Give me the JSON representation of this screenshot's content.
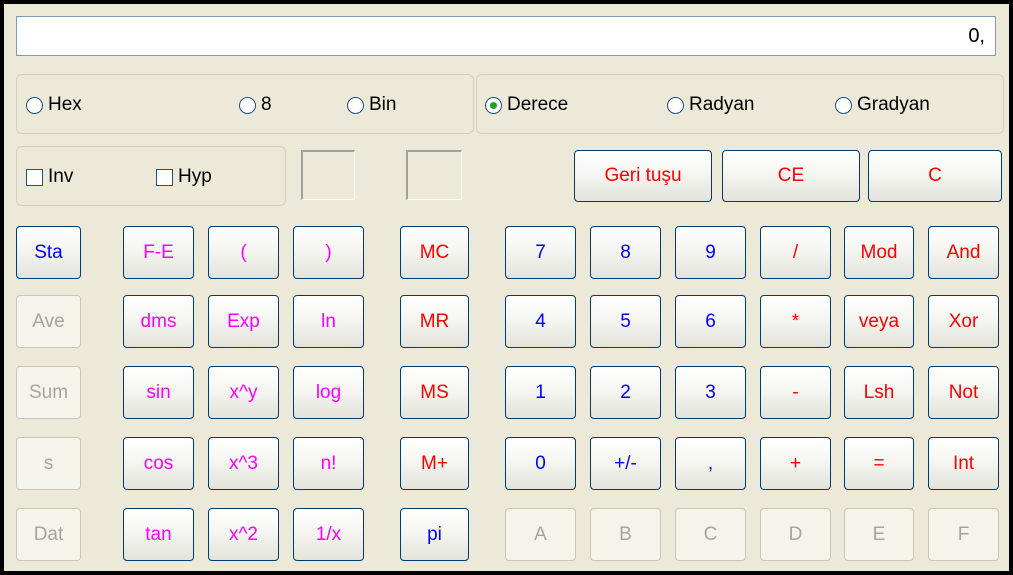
{
  "display": {
    "value": "0,"
  },
  "radix": {
    "hex": "Hex",
    "oct": "8",
    "bin": "Bin",
    "selected": "none"
  },
  "angle": {
    "deg": "Derece",
    "rad": "Radyan",
    "grad": "Gradyan",
    "selected": "Derece"
  },
  "checks": {
    "inv": "Inv",
    "hyp": "Hyp"
  },
  "edit": {
    "back": "Geri tuşu",
    "ce": "CE",
    "c": "C"
  },
  "stats": {
    "sta": "Sta",
    "ave": "Ave",
    "sum": "Sum",
    "s": "s",
    "dat": "Dat"
  },
  "sci": {
    "fe": "F-E",
    "lparen": "(",
    "rparen": ")",
    "dms": "dms",
    "exp": "Exp",
    "ln": "ln",
    "sin": "sin",
    "xy": "x^y",
    "log": "log",
    "cos": "cos",
    "x3": "x^3",
    "fact": "n!",
    "tan": "tan",
    "x2": "x^2",
    "recip": "1/x"
  },
  "memory": {
    "mc": "MC",
    "mr": "MR",
    "ms": "MS",
    "mplus": "M+",
    "pi": "pi"
  },
  "numpad": {
    "d7": "7",
    "d8": "8",
    "d9": "9",
    "div": "/",
    "mod": "Mod",
    "and": "And",
    "d4": "4",
    "d5": "5",
    "d6": "6",
    "mul": "*",
    "or": "veya",
    "xor": "Xor",
    "d1": "1",
    "d2": "2",
    "d3": "3",
    "sub": "-",
    "lsh": "Lsh",
    "not": "Not",
    "d0": "0",
    "sign": "+/-",
    "dot": ",",
    "add": "+",
    "eq": "=",
    "int": "Int"
  },
  "hexdigits": {
    "a": "A",
    "b": "B",
    "c": "C",
    "d": "D",
    "e": "E",
    "f": "F"
  },
  "colors": {
    "blue_keys": "#0000ff",
    "red_keys": "#ff0000",
    "magenta_keys": "#ff00ff",
    "disabled": "#a5a5a0"
  }
}
